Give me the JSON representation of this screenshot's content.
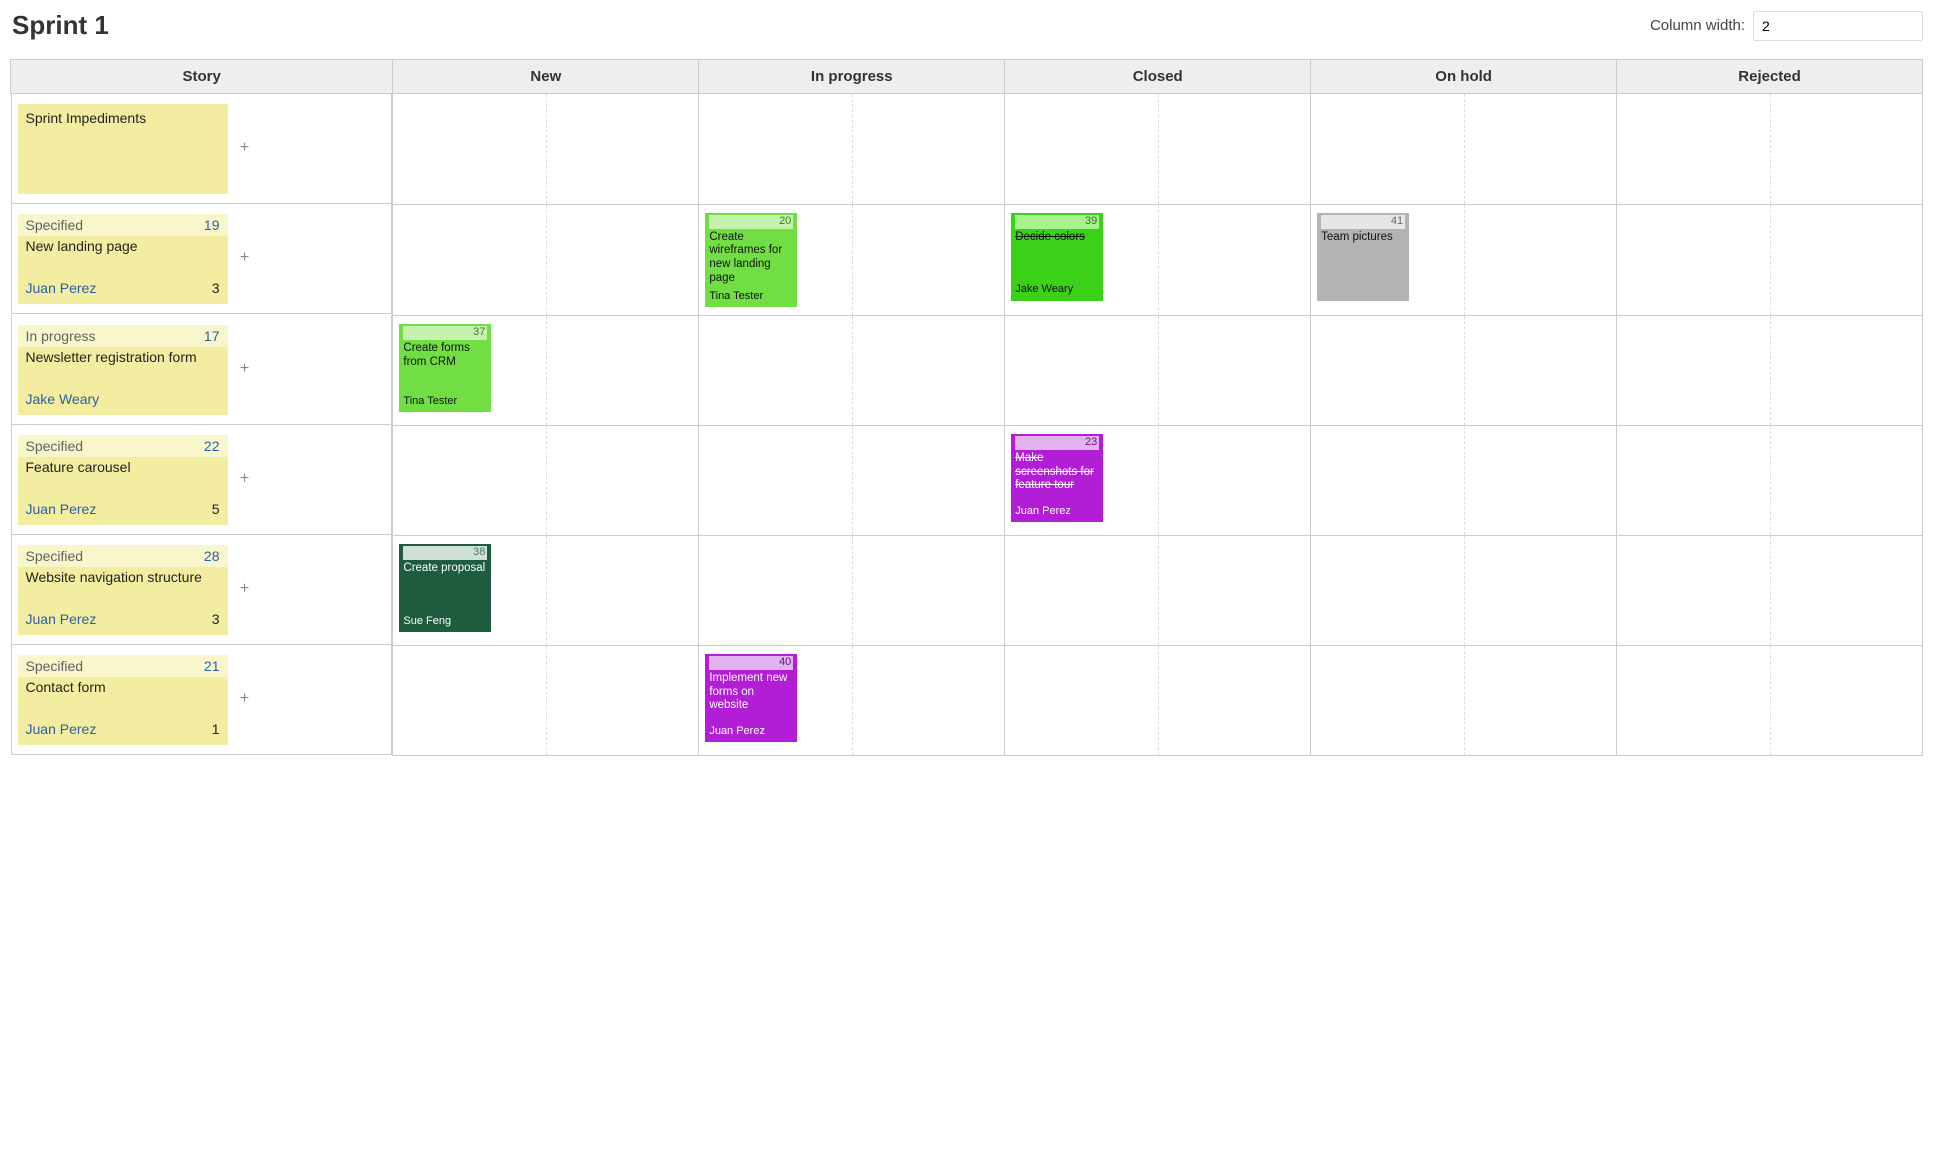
{
  "page": {
    "title": "Sprint 1",
    "column_width_label": "Column width:",
    "column_width_value": "2"
  },
  "columns": {
    "story": "Story",
    "new": "New",
    "in_progress": "In progress",
    "closed": "Closed",
    "on_hold": "On hold",
    "rejected": "Rejected"
  },
  "add_label": "+",
  "rows": [
    {
      "story": {
        "impediments_only": true,
        "title": "Sprint Impediments"
      }
    },
    {
      "story": {
        "status": "Specified",
        "id": "19",
        "title": "New landing page",
        "assignee": "Juan Perez",
        "points": "3"
      },
      "in_progress": [
        {
          "id": "20",
          "title": "Create wireframes for new landing page",
          "assignee": "Tina Tester",
          "color": "c-lightgreen"
        }
      ],
      "closed": [
        {
          "id": "39",
          "title": "Decide colors",
          "assignee": "Jake Weary",
          "color": "c-green",
          "struck": true
        }
      ],
      "on_hold": [
        {
          "id": "41",
          "title": "Team pictures",
          "assignee": "",
          "color": "c-gray"
        }
      ]
    },
    {
      "story": {
        "status": "In progress",
        "id": "17",
        "title": "Newsletter registration form",
        "assignee": "Jake Weary",
        "points": ""
      },
      "new": [
        {
          "id": "37",
          "title": "Create forms from CRM",
          "assignee": "Tina Tester",
          "color": "c-lightgreen"
        }
      ]
    },
    {
      "story": {
        "status": "Specified",
        "id": "22",
        "title": "Feature carousel",
        "assignee": "Juan Perez",
        "points": "5"
      },
      "closed": [
        {
          "id": "23",
          "title": "Make screenshots for feature tour",
          "assignee": "Juan Perez",
          "color": "c-purple",
          "struck": true,
          "light": true
        }
      ]
    },
    {
      "story": {
        "status": "Specified",
        "id": "28",
        "title": "Website navigation structure",
        "assignee": "Juan Perez",
        "points": "3"
      },
      "new": [
        {
          "id": "38",
          "title": "Create proposal",
          "assignee": "Sue Feng",
          "color": "c-darkgreen",
          "light": true
        }
      ]
    },
    {
      "story": {
        "status": "Specified",
        "id": "21",
        "title": "Contact form",
        "assignee": "Juan Perez",
        "points": "1"
      },
      "in_progress": [
        {
          "id": "40",
          "title": "Implement new forms on website",
          "assignee": "Juan Perez",
          "color": "c-purple",
          "light": true
        }
      ]
    }
  ]
}
